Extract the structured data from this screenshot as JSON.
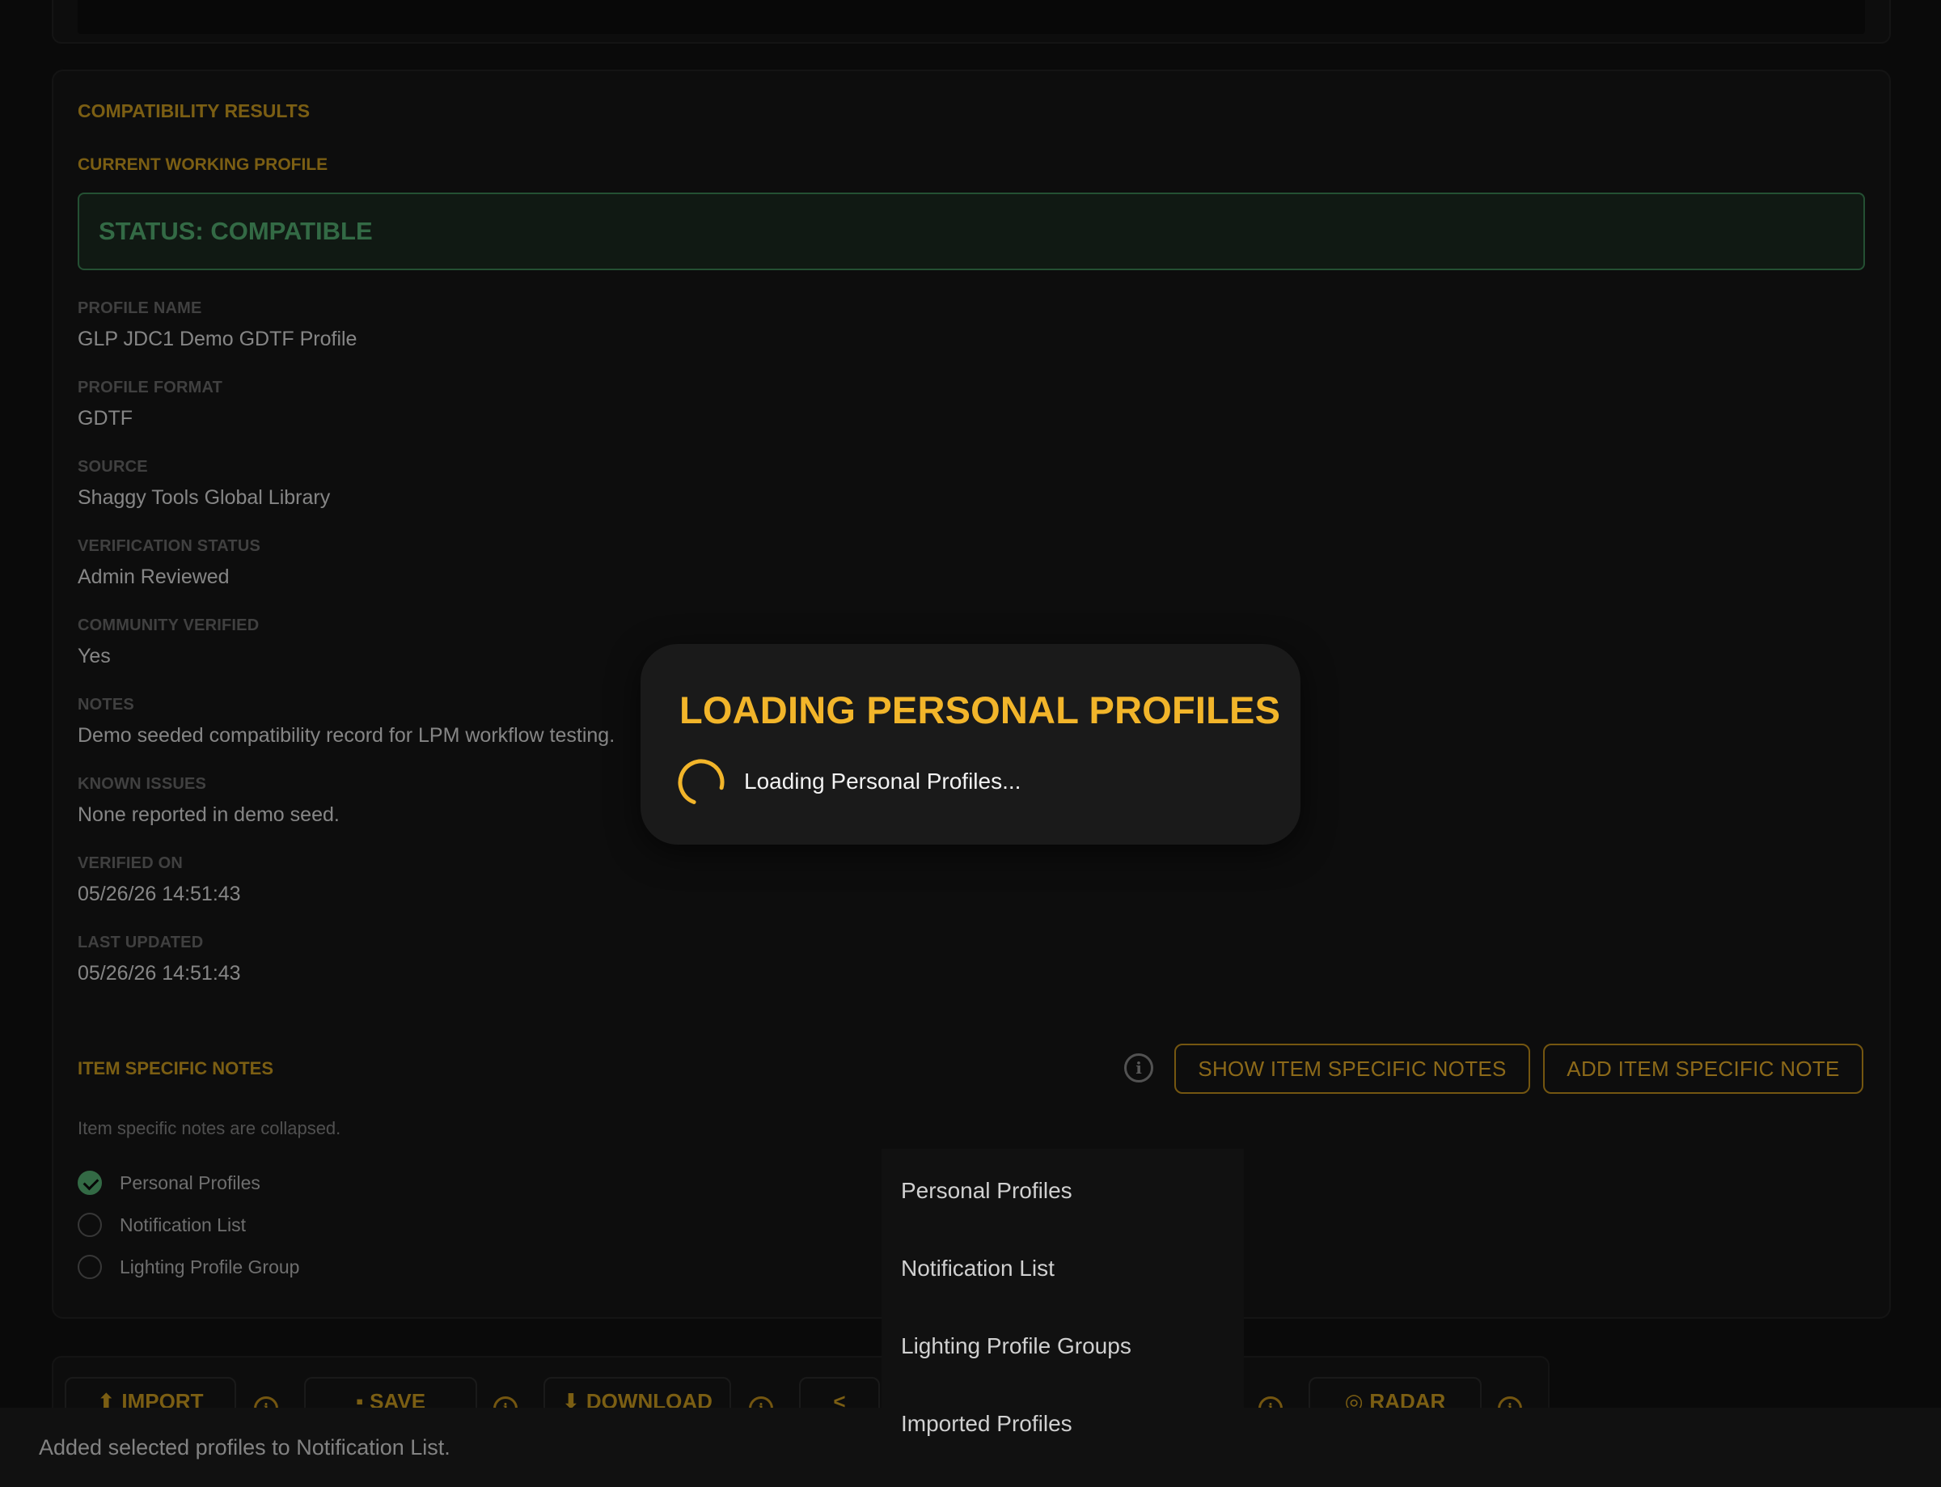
{
  "results": {
    "section_title": "COMPATIBILITY RESULTS",
    "subsection_title": "CURRENT WORKING PROFILE",
    "status": "STATUS: COMPATIBLE",
    "fields": [
      {
        "label": "PROFILE NAME",
        "value": "GLP JDC1 Demo GDTF Profile"
      },
      {
        "label": "PROFILE FORMAT",
        "value": "GDTF"
      },
      {
        "label": "SOURCE",
        "value": "Shaggy Tools Global Library"
      },
      {
        "label": "VERIFICATION STATUS",
        "value": "Admin Reviewed"
      },
      {
        "label": "COMMUNITY VERIFIED",
        "value": "Yes"
      },
      {
        "label": "NOTES",
        "value": "Demo seeded compatibility record for LPM workflow testing."
      },
      {
        "label": "KNOWN ISSUES",
        "value": "None reported in demo seed."
      },
      {
        "label": "VERIFIED ON",
        "value": "05/26/26 14:51:43"
      },
      {
        "label": "LAST UPDATED",
        "value": "05/26/26 14:51:43"
      }
    ]
  },
  "item_notes": {
    "title": "ITEM SPECIFIC NOTES",
    "show_label": "SHOW ITEM SPECIFIC NOTES",
    "add_label": "ADD ITEM SPECIFIC NOTE",
    "collapsed_text": "Item specific notes are collapsed.",
    "targets": [
      {
        "label": "Personal Profiles",
        "checked": true
      },
      {
        "label": "Notification List",
        "checked": false
      },
      {
        "label": "Lighting Profile Group",
        "checked": false
      }
    ]
  },
  "toolbar": {
    "import_label": "IMPORT",
    "save_label": "SAVE",
    "download_label": "DOWNLOAD",
    "radar_label": "RADAR"
  },
  "menu": {
    "items": [
      "Personal Profiles",
      "Notification List",
      "Lighting Profile Groups",
      "Imported Profiles"
    ]
  },
  "dialog": {
    "title": "LOADING PERSONAL PROFILES",
    "message": "Loading Personal Profiles..."
  },
  "snackbar": {
    "message": "Added selected profiles to Notification List."
  },
  "colors": {
    "accent": "#f2b52a",
    "success": "#59b778",
    "background": "#121212"
  }
}
